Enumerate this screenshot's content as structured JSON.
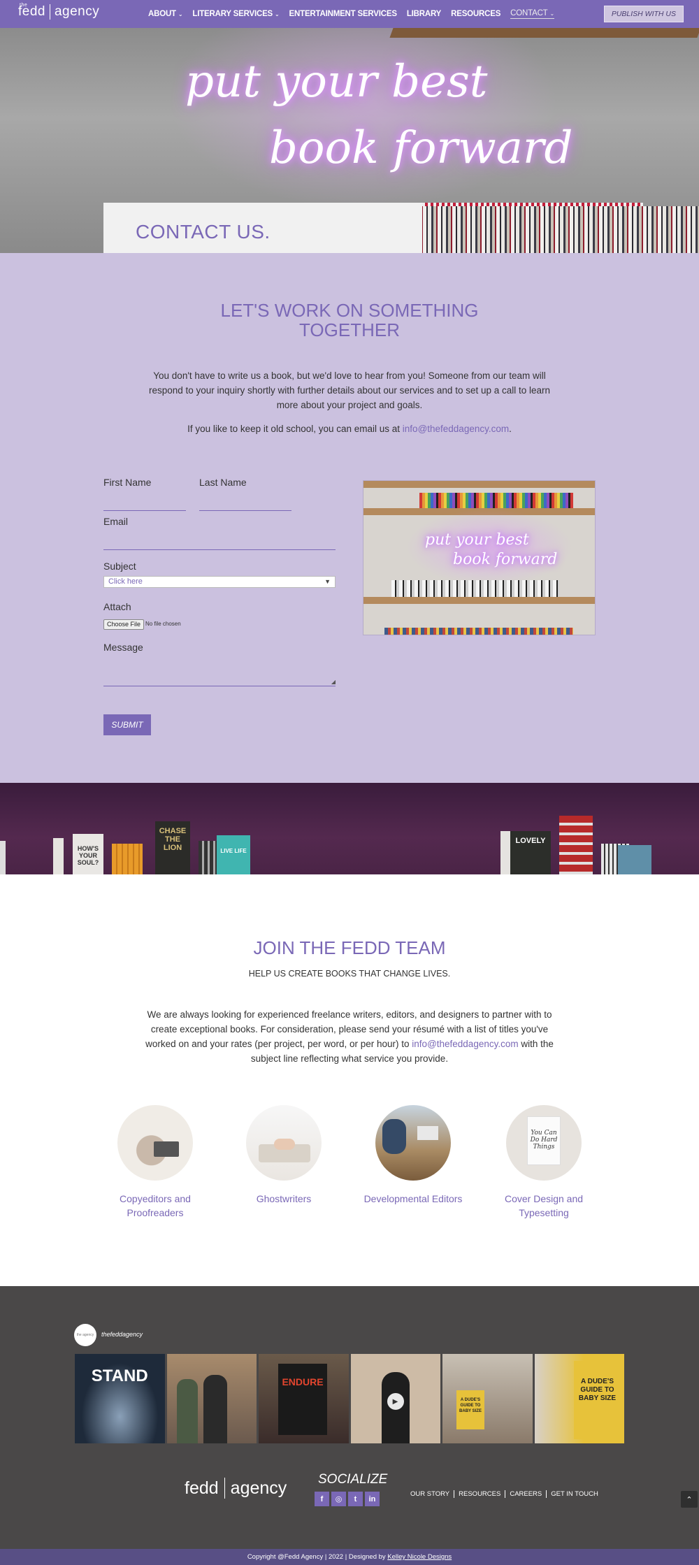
{
  "nav": {
    "logo_small": "the",
    "logo_left": "fedd",
    "logo_right": "agency",
    "items": [
      {
        "label": "ABOUT",
        "caret": "⌄"
      },
      {
        "label": "LITERARY SERVICES",
        "caret": "⌄"
      },
      {
        "label": "ENTERTAINMENT SERVICES"
      },
      {
        "label": "LIBRARY"
      },
      {
        "label": "RESOURCES"
      },
      {
        "label": "CONTACT",
        "caret": "⌄",
        "active": true
      }
    ],
    "cta": "PUBLISH WITH US"
  },
  "hero": {
    "neon_line1": "put your best",
    "neon_line2": "book forward",
    "title": "CONTACT US."
  },
  "work": {
    "heading": "LET'S WORK ON SOMETHING TOGETHER",
    "intro": "You don't have to write us a book, but we'd love to hear from you! Someone from our team will respond to your inquiry shortly with further details about our services and to set up a call to learn more about your project and goals.",
    "oldschool_prefix": "If you like to keep it old school, you can email us at ",
    "email": "info@thefeddagency.com",
    "oldschool_suffix": "."
  },
  "form": {
    "first_name_label": "First Name",
    "last_name_label": "Last Name",
    "email_label": "Email",
    "subject_label": "Subject",
    "subject_value": "Click here",
    "attach_label": "Attach",
    "file_button": "Choose File",
    "file_status": "No file chosen",
    "message_label": "Message",
    "submit_label": "SUBMIT"
  },
  "photo": {
    "neon_line1": "put your best",
    "neon_line2": "book forward"
  },
  "banner": {
    "books": [
      {
        "title": "HOW'S YOUR SOUL?",
        "color": "#e9e7e4",
        "text_color": "#333"
      },
      {
        "title": "CHASE THE LION",
        "color": "#2b2b28",
        "text_color": "#d8c07a"
      },
      {
        "title": "LIVE LIFE",
        "color": "#40b5b0",
        "text_color": "#fff"
      },
      {
        "title": "LOVELY",
        "color": "#2c2e2a",
        "text_color": "#fff"
      }
    ]
  },
  "join": {
    "heading": "JOIN THE FEDD TEAM",
    "subheading": "HELP US CREATE BOOKS THAT CHANGE LIVES.",
    "para_prefix": "We are always looking for experienced freelance writers, editors, and designers to partner with to create exceptional books. For consideration, please send your résumé with a list of titles you've worked on and your rates (per project, per word, or per hour) to ",
    "email": "info@thefeddagency.com",
    "para_suffix": " with the subject line reflecting what service you provide.",
    "roles": [
      {
        "label": "Copyeditors and Proofreaders"
      },
      {
        "label": "Ghostwriters"
      },
      {
        "label": "Developmental Editors"
      },
      {
        "label": "Cover Design and Typesetting"
      }
    ]
  },
  "instagram": {
    "avatar_text": "the agency",
    "handle": "thefeddagency",
    "tiles": [
      {
        "caption": "STAND",
        "color": "#1e2a3a"
      },
      {
        "caption": "",
        "color": "#6b5a4e"
      },
      {
        "caption": "ENDURE",
        "color": "#3a2c2a"
      },
      {
        "caption": "",
        "color": "#cdbba6"
      },
      {
        "caption": "A DUDE'S GUIDE TO BABY SIZE",
        "color": "#8a7a6a"
      },
      {
        "caption": "A DUDE'S GUIDE TO BABY SIZE",
        "color": "#e7c23a"
      }
    ]
  },
  "footer": {
    "logo_small": "the",
    "logo_left": "fedd",
    "logo_right": "agency",
    "socialize": "SOCIALIZE",
    "social": [
      "f",
      "◎",
      "t",
      "in"
    ],
    "links": [
      "OUR STORY",
      "RESOURCES",
      "CAREERS",
      "GET IN TOUCH"
    ],
    "to_top": "⌃"
  },
  "copyright": {
    "text": "Copyright @Fedd Agency | 2022 | Designed by ",
    "designer": "Kelley Nicole Designs"
  },
  "colors": {
    "brand_purple": "#7a68b6",
    "lavender_bg": "#cbc1df",
    "dark_footer": "#4a4848",
    "copyright_bar": "#584f85"
  }
}
